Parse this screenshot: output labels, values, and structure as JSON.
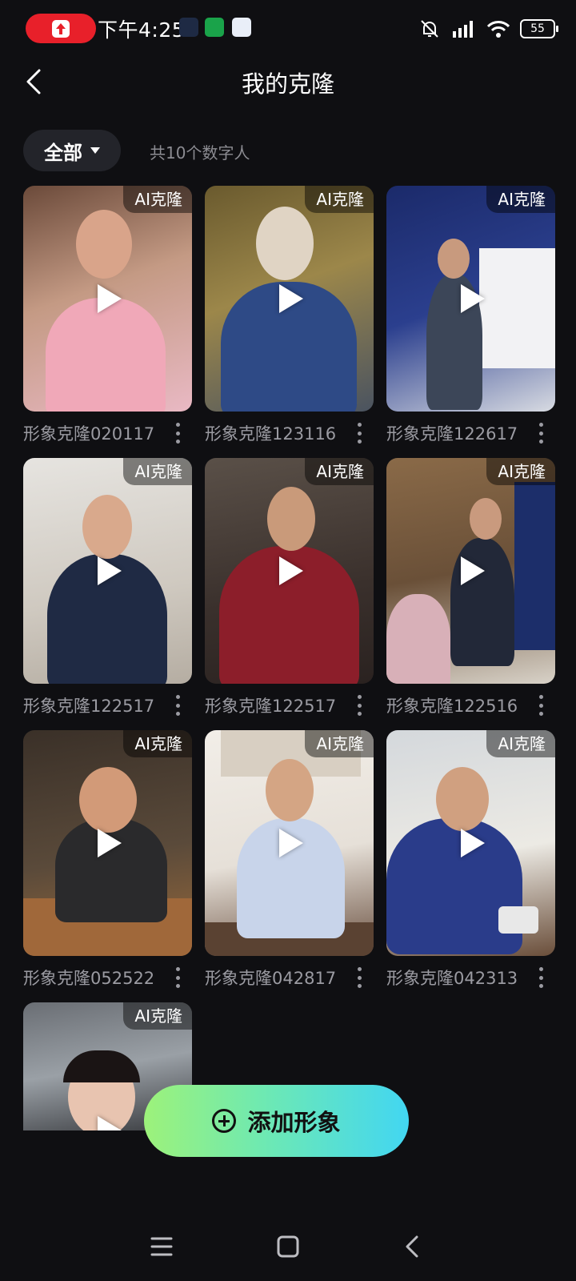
{
  "status_bar": {
    "time": "下午4:25",
    "battery": "55"
  },
  "header": {
    "title": "我的克隆"
  },
  "filter": {
    "selected": "全部",
    "count_text": "共10个数字人"
  },
  "badge_text": "AI克隆",
  "clones": [
    {
      "label": "形象克隆020117"
    },
    {
      "label": "形象克隆123116"
    },
    {
      "label": "形象克隆122617"
    },
    {
      "label": "形象克隆122517"
    },
    {
      "label": "形象克隆122517"
    },
    {
      "label": "形象克隆122516"
    },
    {
      "label": "形象克隆052522"
    },
    {
      "label": "形象克隆042817"
    },
    {
      "label": "形象克隆042313"
    },
    {
      "label": ""
    }
  ],
  "add_button": {
    "label": "添加形象"
  },
  "colors": {
    "accent_start": "#9df27a",
    "accent_end": "#42d6f2",
    "background": "#0f0f12"
  }
}
